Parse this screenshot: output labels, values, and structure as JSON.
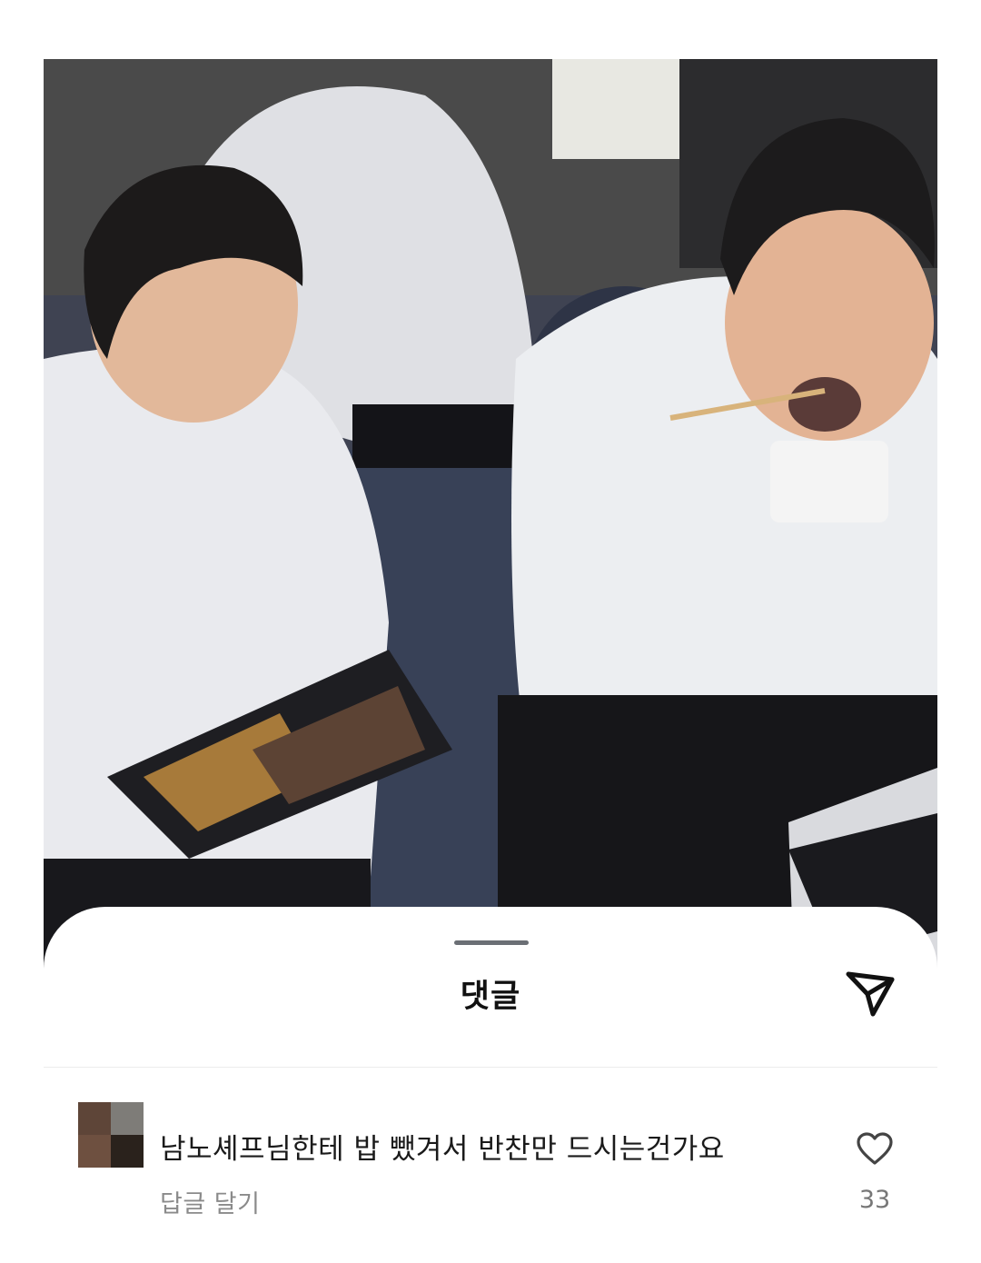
{
  "photo": {
    "description_icon": "photo-two-chefs-eating-icon"
  },
  "comments_sheet": {
    "title": "댓글",
    "share_icon": "send-icon"
  },
  "comment": {
    "avatar_colors": [
      "#5e4538",
      "#7e7c78",
      "#6e5040",
      "#2a221c"
    ],
    "text": "남노셰프님한테 밥 뺐겨서 반찬만 드시는건가요",
    "reply_label": "답글 달기",
    "like_icon": "heart-outline-icon",
    "like_count": "33"
  }
}
